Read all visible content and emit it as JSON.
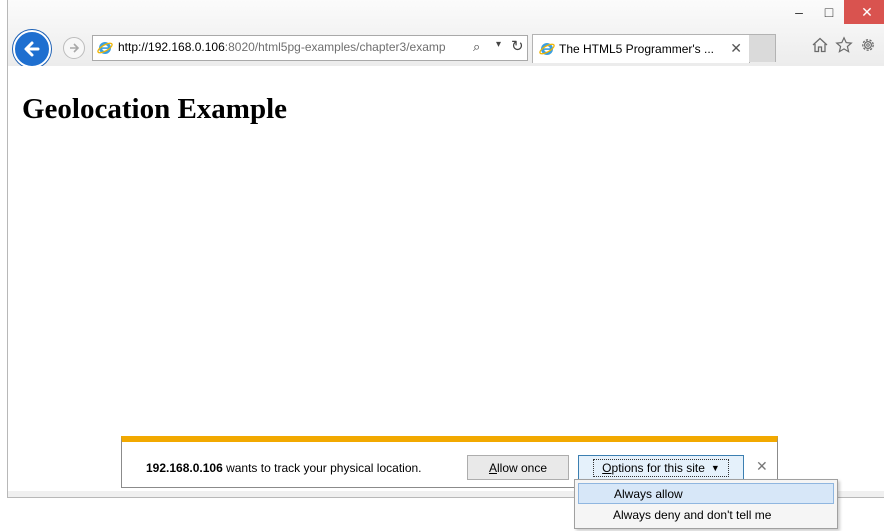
{
  "window": {
    "controls": {
      "minimize": "–",
      "maximize": "□",
      "close": "✕"
    }
  },
  "address_bar": {
    "url_host": "http://192.168.0.106",
    "url_rest": ":8020/html5pg-examples/chapter3/examp",
    "search_icon": "⌕",
    "dropdown_icon": "▾",
    "refresh_icon": "↻"
  },
  "tab": {
    "title": "The HTML5 Programmer's ...",
    "close": "✕"
  },
  "page": {
    "heading": "Geolocation Example"
  },
  "notification": {
    "host": "192.168.0.106",
    "message": " wants to track your physical location.",
    "allow_once": "Allow once",
    "allow_once_accesskey": "A",
    "allow_once_rest": "llow once",
    "options_accesskey": "O",
    "options_rest": "ptions for this site",
    "options_caret": "▼",
    "close": "✕",
    "accent_color": "#f2a900"
  },
  "options_menu": {
    "items": [
      {
        "label": "Always allow",
        "highlighted": true
      },
      {
        "label": "Always deny and don't tell me",
        "highlighted": false
      }
    ]
  }
}
